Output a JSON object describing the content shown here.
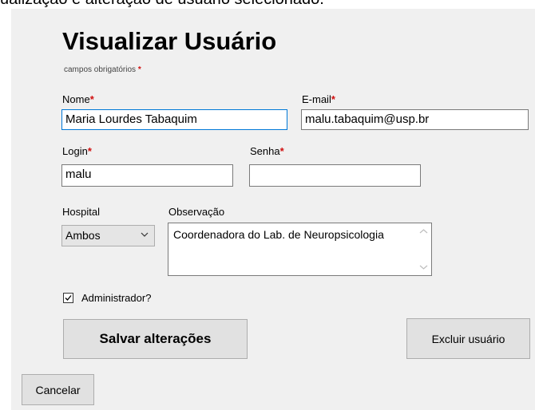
{
  "header": {
    "caption": "ualização e alteração de usuário selecionado."
  },
  "form": {
    "title": "Visualizar Usuário",
    "required_note": "campos obrigatórios",
    "required_marker": "*",
    "fields": {
      "nome": {
        "label": "Nome",
        "value": "Maria Lourdes Tabaquim"
      },
      "email": {
        "label": "E-mail",
        "value": "malu.tabaquim@usp.br"
      },
      "login": {
        "label": "Login",
        "value": "malu"
      },
      "senha": {
        "label": "Senha",
        "value": ""
      },
      "hospital": {
        "label": "Hospital",
        "value": "Ambos"
      },
      "observacao": {
        "label": "Observação",
        "value": "Coordenadora do Lab. de Neuropsicologia"
      }
    },
    "admin": {
      "label": "Administrador?",
      "checked": true
    }
  },
  "buttons": {
    "save": "Salvar alterações",
    "delete": "Excluir usuário",
    "cancel": "Cancelar"
  },
  "colors": {
    "required": "#d01010",
    "focus_border": "#0078d7",
    "panel_bg": "#f0f0f0",
    "button_bg": "#e1e1e1"
  }
}
